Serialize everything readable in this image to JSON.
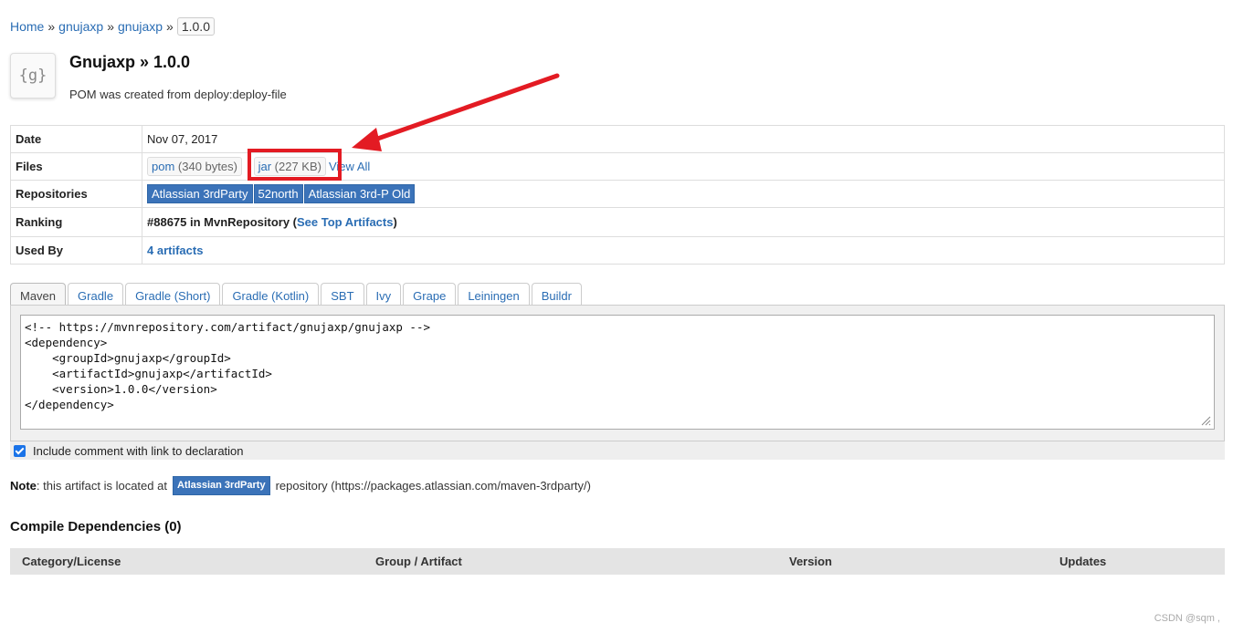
{
  "breadcrumb": [
    "Home",
    "gnujaxp",
    "gnujaxp",
    "1.0.0"
  ],
  "breadcrumb_sep": "»",
  "artifact": {
    "logo_text": "{g}",
    "title": "Gnujaxp » 1.0.0",
    "description": "POM was created from deploy:deploy-file"
  },
  "info": {
    "date_label": "Date",
    "date": "Nov 07, 2017",
    "files_label": "Files",
    "files": [
      {
        "name": "pom",
        "size": "(340 bytes)"
      },
      {
        "name": "jar",
        "size": "(227 KB)"
      }
    ],
    "view_all": "View All",
    "repositories_label": "Repositories",
    "repositories": [
      "Atlassian 3rdParty",
      "52north",
      "Atlassian 3rd-P Old"
    ],
    "ranking_label": "Ranking",
    "ranking_prefix": "#88675 in MvnRepository (",
    "ranking_link": "See Top Artifacts",
    "ranking_suffix": ")",
    "used_by_label": "Used By",
    "used_by": "4 artifacts"
  },
  "tabs": [
    "Maven",
    "Gradle",
    "Gradle (Short)",
    "Gradle (Kotlin)",
    "SBT",
    "Ivy",
    "Grape",
    "Leiningen",
    "Buildr"
  ],
  "active_tab": "Maven",
  "snippet": "<!-- https://mvnrepository.com/artifact/gnujaxp/gnujaxp -->\n<dependency>\n    <groupId>gnujaxp</groupId>\n    <artifactId>gnujaxp</artifactId>\n    <version>1.0.0</version>\n</dependency>",
  "include_comment": {
    "checked": true,
    "label": "Include comment with link to declaration"
  },
  "note": {
    "label": "Note",
    "prefix": ": this artifact is located at",
    "repo": "Atlassian 3rdParty",
    "suffix": "repository (https://packages.atlassian.com/maven-3rdparty/)"
  },
  "compile_deps": {
    "heading": "Compile Dependencies (0)",
    "columns": [
      "Category/License",
      "Group / Artifact",
      "Version",
      "Updates"
    ]
  },
  "watermark": "CSDN @sqm ,",
  "annotation_color": "#e31b23"
}
